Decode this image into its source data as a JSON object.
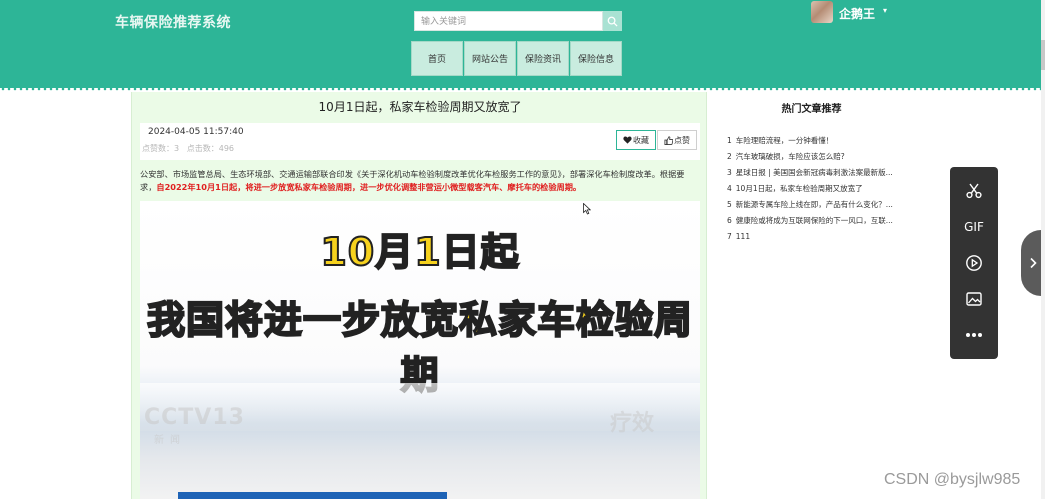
{
  "header": {
    "site_title": "车辆保险推荐系统",
    "search_placeholder": "输入关键词",
    "user_name": "企鹅王",
    "caret": "▾",
    "nav": [
      {
        "label": "首页"
      },
      {
        "label": "网站公告"
      },
      {
        "label": "保险资讯"
      },
      {
        "label": "保险信息"
      }
    ]
  },
  "article": {
    "title": "10月1日起，私家车检验周期又放宽了",
    "timestamp": "2024-04-05 11:57:40",
    "likes_label": "点赞数：",
    "likes_value": "3",
    "clicks_label": "点击数：",
    "clicks_value": "496",
    "favorite_label": "收藏",
    "like_label": "点赞",
    "body_normal": "公安部、市场监管总局、生态环境部、交通运输部联合印发《关于深化机动车检验制度改革优化车检服务工作的意见》，部署深化车检制度改革。根据要求，",
    "body_highlight": "自2022年10月1日起，将进一步放宽私家车检验周期，进一步优化调整非营运小微型载客汽车、摩托车的检验周期。",
    "image": {
      "line1": "10月1日起",
      "line2": "我国将进一步放宽私家车检验周期",
      "logo_left": "CCTV13",
      "logo_left_sub": "新闻",
      "logo_right": "疗效"
    }
  },
  "sidebar": {
    "title": "热门文章推荐",
    "items": [
      {
        "num": "1",
        "text": "车险理赔流程，一分钟看懂！"
      },
      {
        "num": "2",
        "text": "汽车玻璃破损，车险应该怎么赔?"
      },
      {
        "num": "3",
        "text": "星球日报 | 美国国会新冠病毒刺激法案最新版..."
      },
      {
        "num": "4",
        "text": "10月1日起，私家车检验周期又放宽了"
      },
      {
        "num": "5",
        "text": "新能源专属车险上线在即，产品有什么变化？..."
      },
      {
        "num": "6",
        "text": "健康险或将成为互联网保险的下一风口，互联..."
      },
      {
        "num": "7",
        "text": "111"
      }
    ]
  },
  "tools": {
    "gif_label": "GIF"
  },
  "watermark": "CSDN @bysjlw985",
  "colors": {
    "header_bg": "#2db597",
    "main_bg": "#ebfbe7",
    "nav_bg": "#c9ecdf",
    "highlight_text": "#e02020",
    "tool_panel_bg": "#333333"
  }
}
